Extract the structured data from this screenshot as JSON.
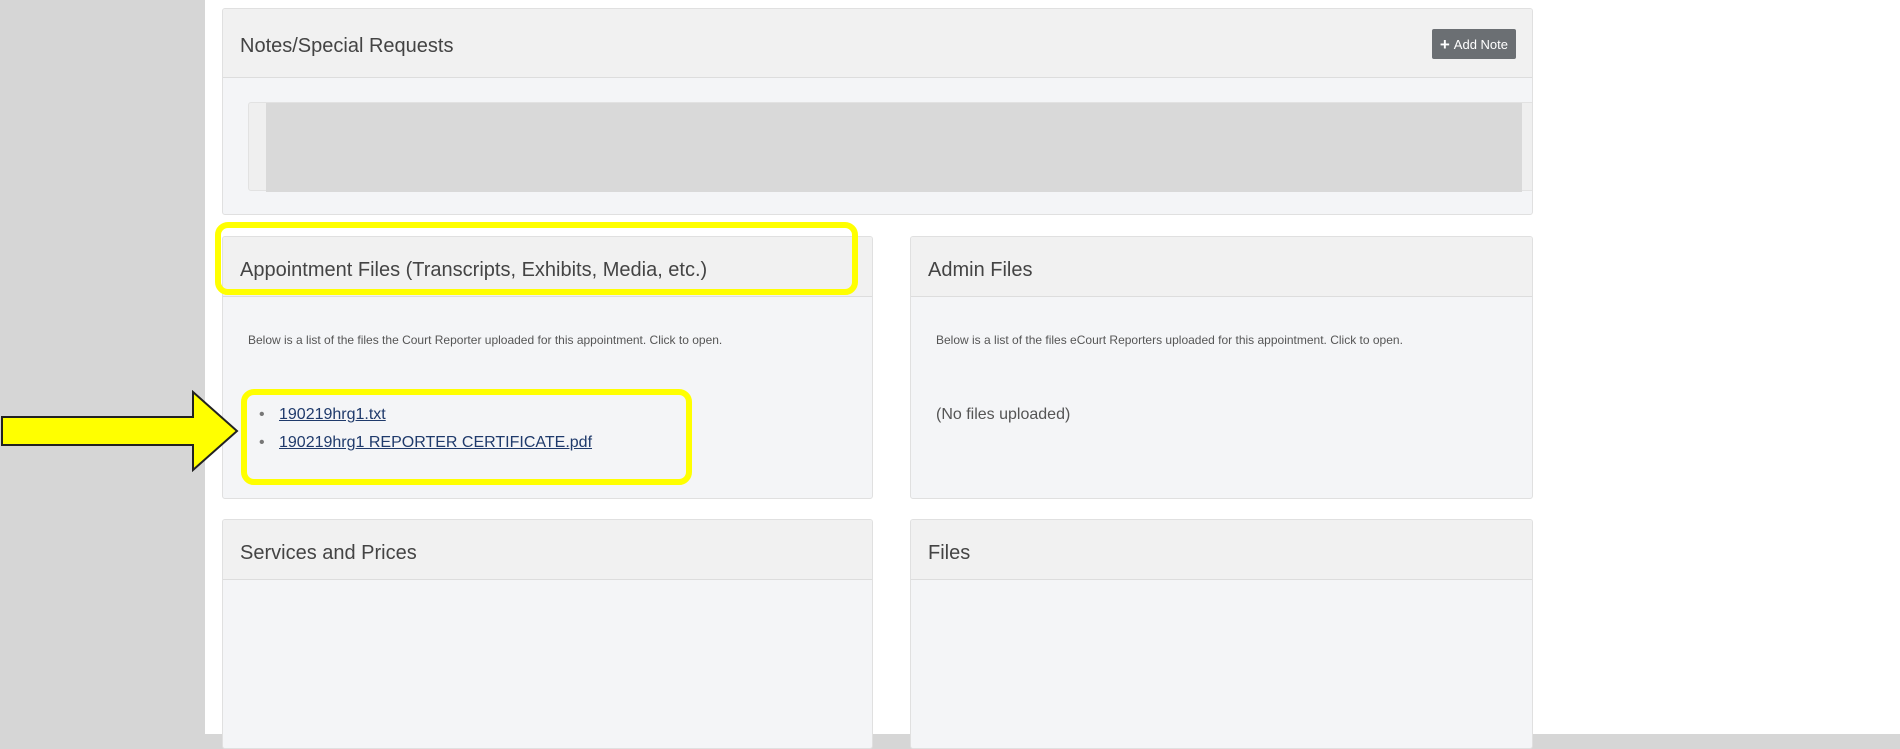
{
  "notes_panel": {
    "title": "Notes/Special Requests",
    "add_note_label": "Add Note"
  },
  "appointment_files": {
    "title": "Appointment Files (Transcripts, Exhibits, Media, etc.)",
    "description": "Below is a list of the files the Court Reporter uploaded for this appointment. Click to open.",
    "files": [
      "190219hrg1.txt",
      "190219hrg1 REPORTER CERTIFICATE.pdf"
    ]
  },
  "admin_files": {
    "title": "Admin Files",
    "description": "Below is a list of the files eCourt Reporters uploaded for this appointment. Click to open.",
    "empty_text": "(No files uploaded)"
  },
  "services_panel": {
    "title": "Services and Prices"
  },
  "files_panel": {
    "title": "Files"
  },
  "colors": {
    "highlight": "#ffff00",
    "arrow_fill": "#ffff00",
    "link": "#1f3a6b",
    "button_bg": "#6b6f73"
  }
}
